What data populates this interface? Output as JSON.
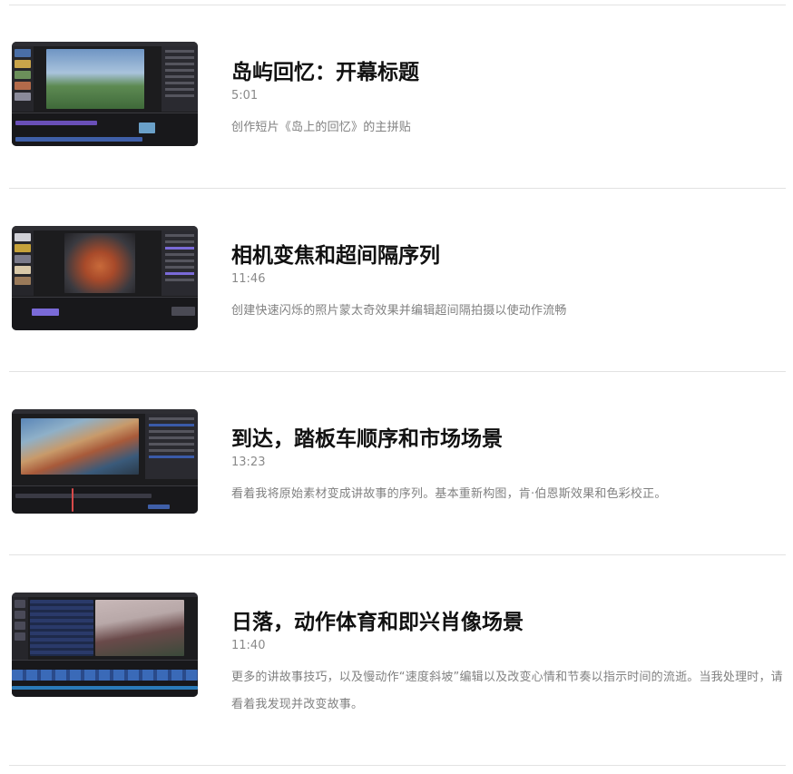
{
  "lessons": [
    {
      "title": "岛屿回忆：开幕标题",
      "duration": "5:01",
      "description": "创作短片《岛上的回忆》的主拼贴",
      "thumbnail_icon": "video-thumbnail-editor-icon"
    },
    {
      "title": "相机变焦和超间隔序列",
      "duration": "11:46",
      "description": "创建快速闪烁的照片蒙太奇效果并编辑超间隔拍摄以使动作流畅",
      "thumbnail_icon": "video-thumbnail-editor-icon"
    },
    {
      "title": "到达，踏板车顺序和市场场景",
      "duration": "13:23",
      "description": "看着我将原始素材变成讲故事的序列。基本重新构图，肯·伯恩斯效果和色彩校正。",
      "thumbnail_icon": "video-thumbnail-editor-icon"
    },
    {
      "title": "日落，动作体育和即兴肖像场景",
      "duration": "11:40",
      "description": "更多的讲故事技巧，以及慢动作“速度斜坡”编辑以及改变心情和节奏以指示时间的流逝。当我处理时，请看着我发现并改变故事。",
      "thumbnail_icon": "video-thumbnail-editor-icon"
    }
  ]
}
